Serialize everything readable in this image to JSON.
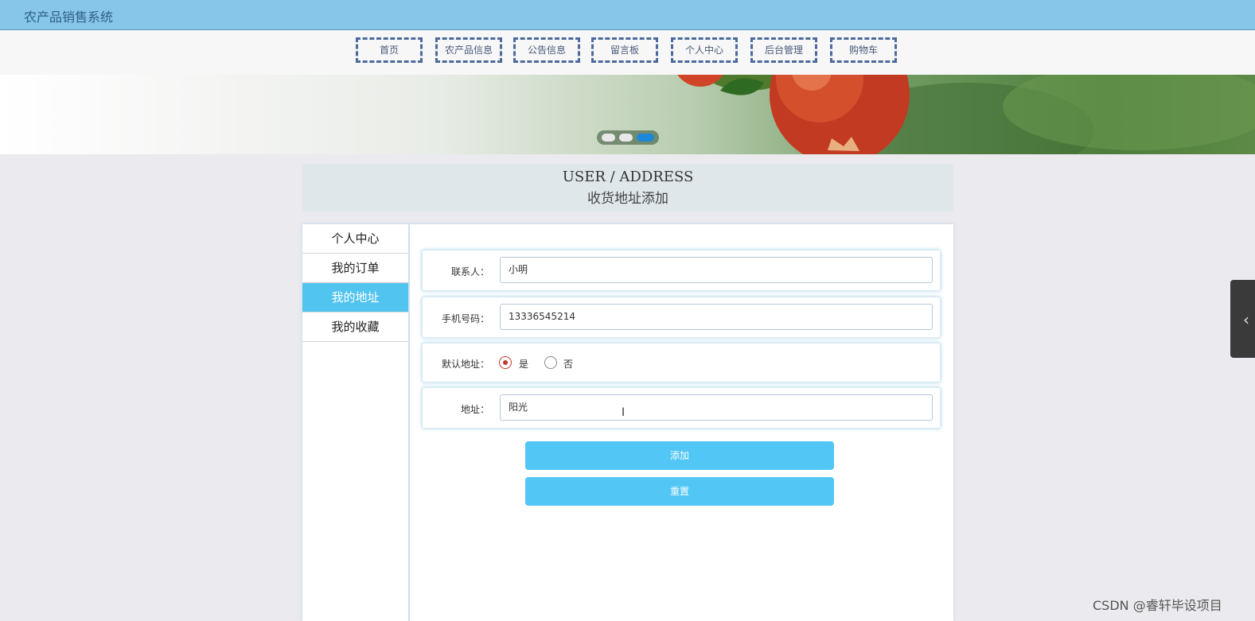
{
  "app": {
    "title": "农产品销售系统"
  },
  "nav": {
    "items": [
      "首页",
      "农产品信息",
      "公告信息",
      "留言板",
      "个人中心",
      "后台管理",
      "购物车"
    ]
  },
  "banner": {
    "active_slide": 3,
    "slide_count": 3
  },
  "page_title": {
    "en": "USER / ADDRESS",
    "cn": "收货地址添加"
  },
  "sidebar": {
    "items": [
      {
        "label": "个人中心"
      },
      {
        "label": "我的订单"
      },
      {
        "label": "我的地址"
      },
      {
        "label": "我的收藏"
      }
    ],
    "active": "我的地址"
  },
  "form": {
    "contact_label": "联系人：",
    "contact_value": "小明",
    "phone_label": "手机号码：",
    "phone_value": "13336545214",
    "default_label": "默认地址：",
    "default_yes": "是",
    "default_no": "否",
    "default_selected": "是",
    "address_label": "地址：",
    "address_value": "阳光"
  },
  "buttons": {
    "add": "添加",
    "reset": "重置"
  },
  "watermark": "CSDN @睿轩毕设项目",
  "colors": {
    "topbar": "#87c6e8",
    "accent": "#52c6f5",
    "nav_border": "#4d6a9c"
  }
}
